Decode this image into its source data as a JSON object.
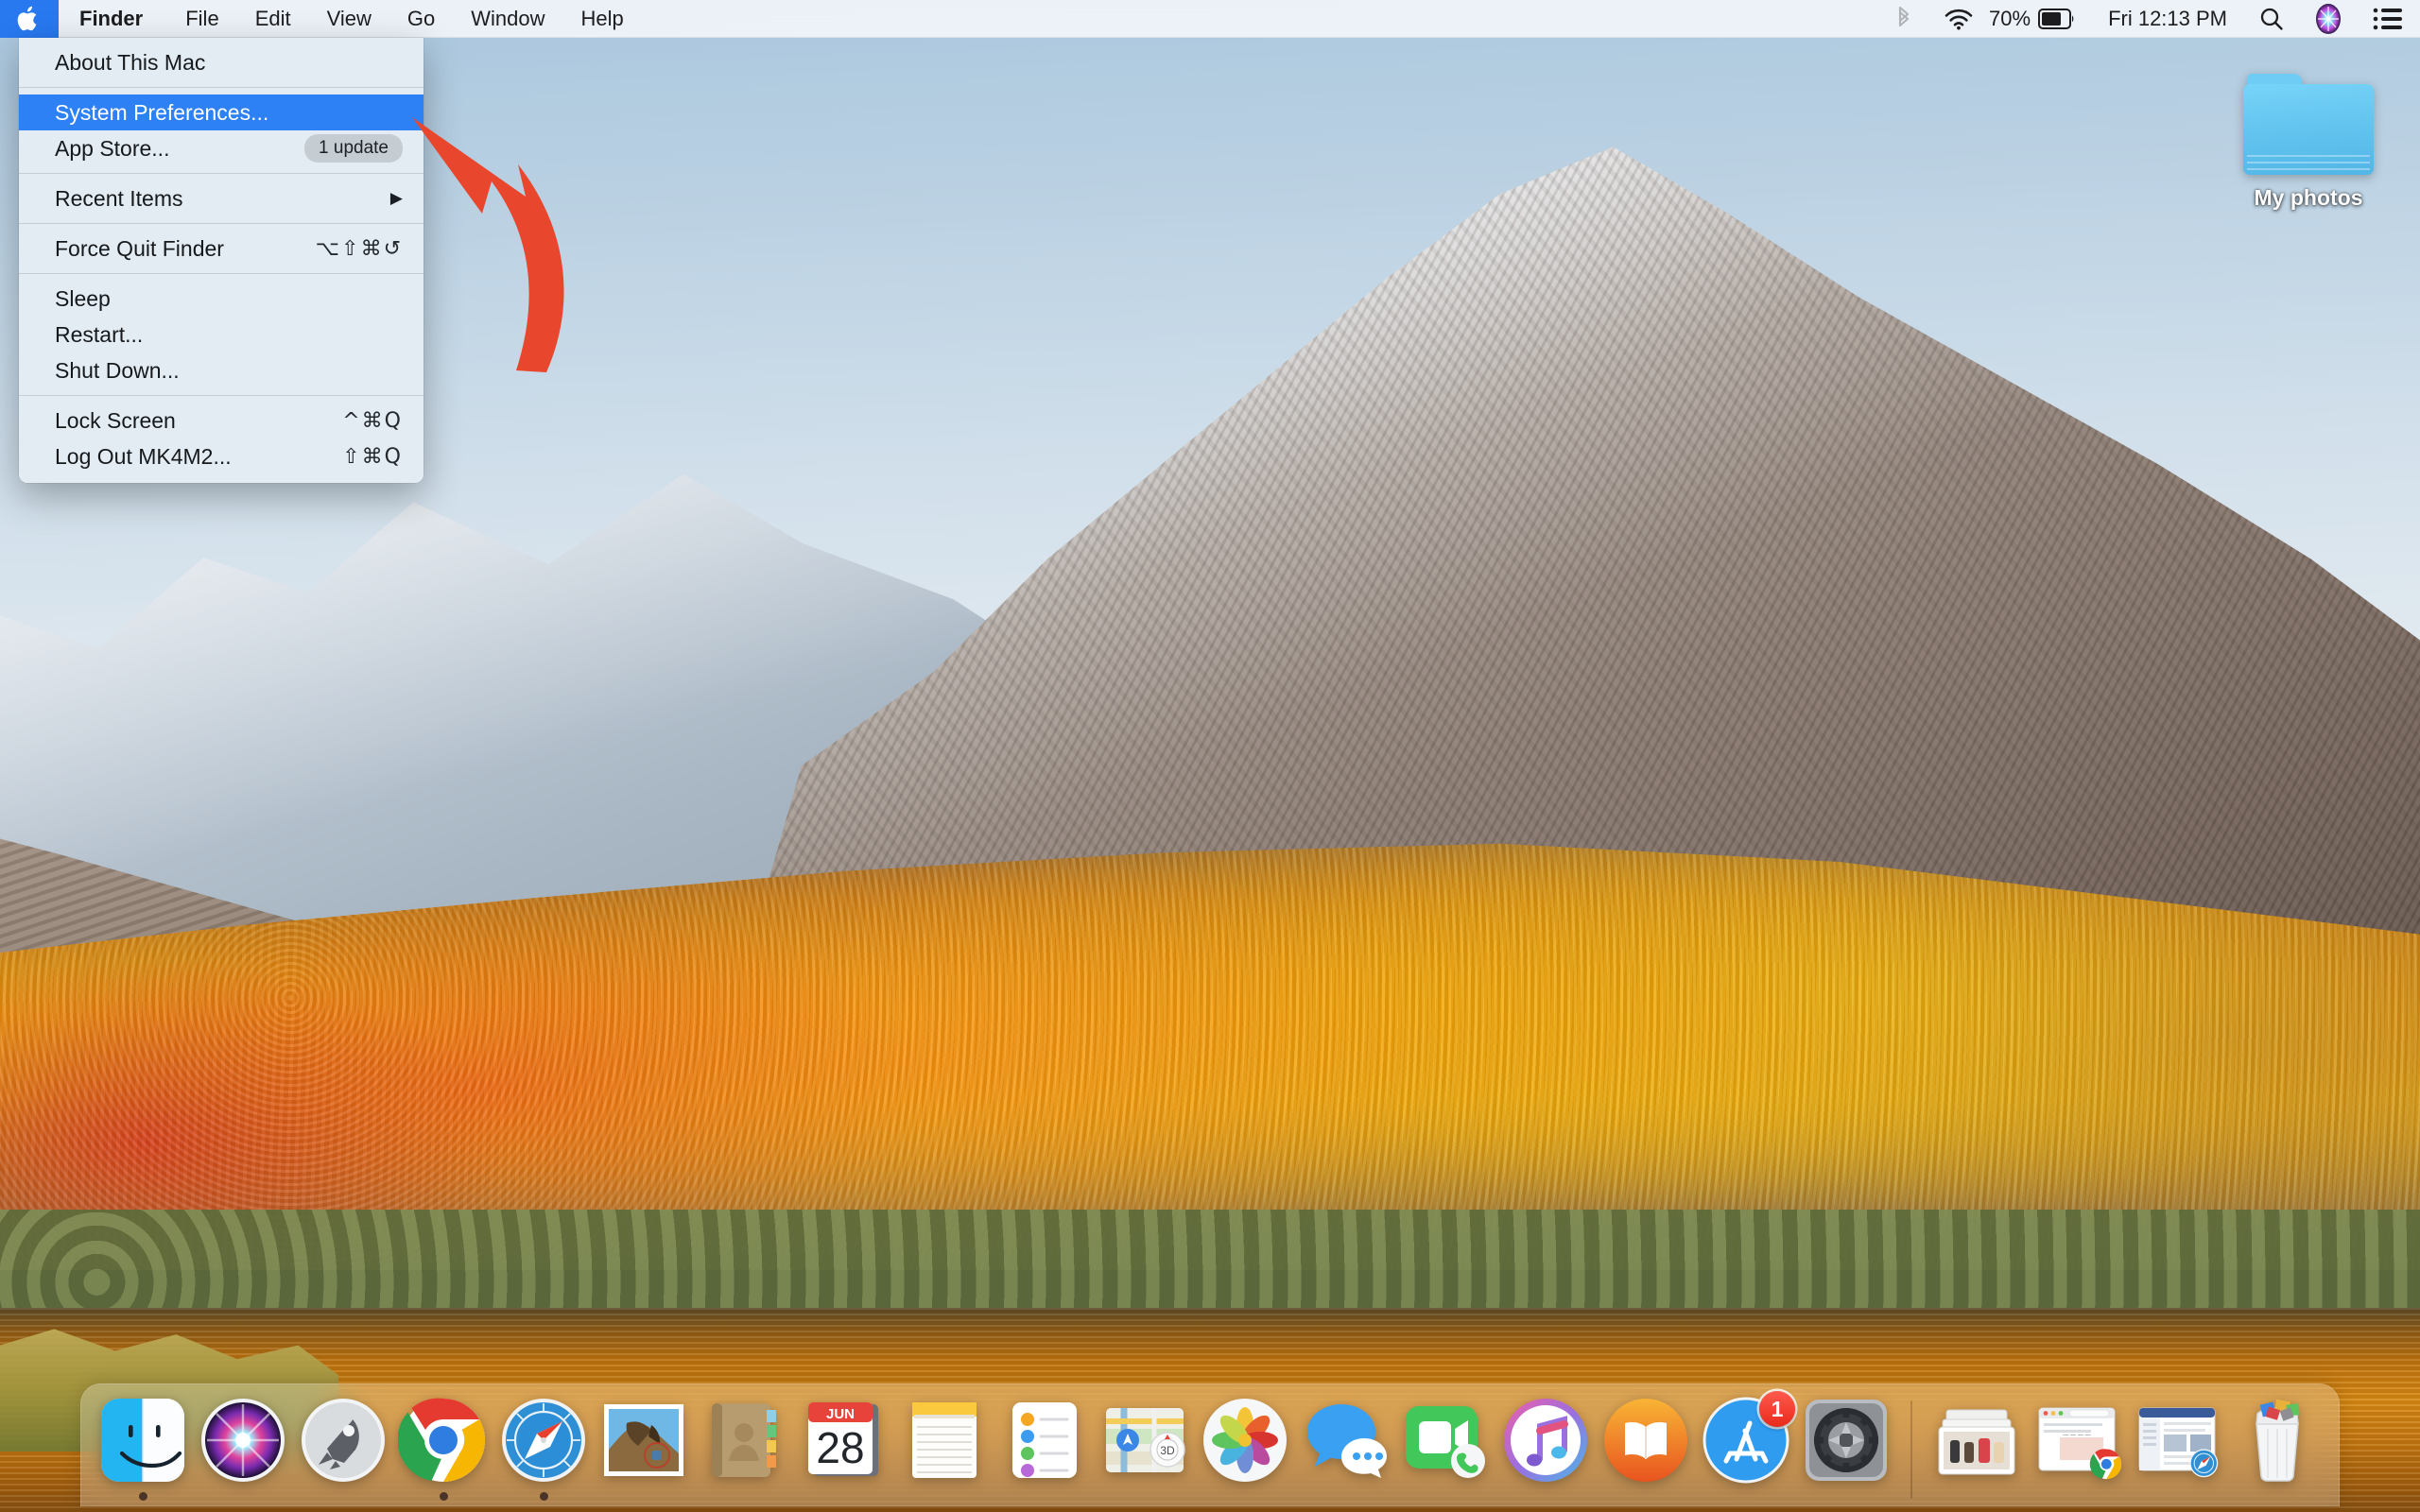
{
  "menubar": {
    "apple_icon": "apple-logo-icon",
    "items": [
      {
        "label": "Finder",
        "bold": true
      },
      {
        "label": "File",
        "bold": false
      },
      {
        "label": "Edit",
        "bold": false
      },
      {
        "label": "View",
        "bold": false
      },
      {
        "label": "Go",
        "bold": false
      },
      {
        "label": "Window",
        "bold": false
      },
      {
        "label": "Help",
        "bold": false
      }
    ],
    "status": {
      "bluetooth_icon": "bluetooth-icon",
      "wifi_icon": "wifi-icon",
      "battery_percent": "70%",
      "battery_icon": "battery-icon",
      "clock": "Fri 12:13 PM",
      "search_icon": "search-icon",
      "siri_icon": "siri-icon",
      "control_center_icon": "notification-center-icon"
    }
  },
  "apple_menu": {
    "selected_index": 1,
    "highlight_color": "#2d81f5",
    "rows": [
      {
        "label": "About This Mac",
        "key": "",
        "badge": "",
        "submenu": false,
        "sep_after": true
      },
      {
        "label": "System Preferences...",
        "key": "",
        "badge": "",
        "submenu": false,
        "sep_after": false
      },
      {
        "label": "App Store...",
        "key": "",
        "badge": "1 update",
        "submenu": false,
        "sep_after": true
      },
      {
        "label": "Recent Items",
        "key": "",
        "badge": "",
        "submenu": true,
        "sep_after": true
      },
      {
        "label": "Force Quit Finder",
        "key": "⌥⇧⌘↺",
        "badge": "",
        "submenu": false,
        "sep_after": true
      },
      {
        "label": "Sleep",
        "key": "",
        "badge": "",
        "submenu": false,
        "sep_after": false
      },
      {
        "label": "Restart...",
        "key": "",
        "badge": "",
        "submenu": false,
        "sep_after": false
      },
      {
        "label": "Shut Down...",
        "key": "",
        "badge": "",
        "submenu": false,
        "sep_after": true
      },
      {
        "label": "Lock Screen",
        "key": "^⌘Q",
        "badge": "",
        "submenu": false,
        "sep_after": false
      },
      {
        "label": "Log Out MK4M2...",
        "key": "⇧⌘Q",
        "badge": "",
        "submenu": false,
        "sep_after": false
      }
    ]
  },
  "annotation": {
    "arrow_name": "red-curved-arrow-pointing-to-system-preferences",
    "color": "#e8472e"
  },
  "desktop": {
    "folder": {
      "name": "My photos",
      "icon": "folder-icon",
      "color": "#63c4ef"
    }
  },
  "dock": {
    "apps": [
      {
        "name": "Finder",
        "icon": "finder-icon",
        "running": true,
        "badge": ""
      },
      {
        "name": "Siri",
        "icon": "siri-icon",
        "running": false,
        "badge": ""
      },
      {
        "name": "Launchpad",
        "icon": "launchpad-icon",
        "running": false,
        "badge": ""
      },
      {
        "name": "Google Chrome",
        "icon": "chrome-icon",
        "running": true,
        "badge": ""
      },
      {
        "name": "Safari",
        "icon": "safari-icon",
        "running": true,
        "badge": ""
      },
      {
        "name": "Mail",
        "icon": "mail-icon",
        "running": false,
        "badge": ""
      },
      {
        "name": "Contacts",
        "icon": "contacts-icon",
        "running": false,
        "badge": ""
      },
      {
        "name": "Calendar",
        "icon": "calendar-icon",
        "running": false,
        "badge": "",
        "month": "JUN",
        "day": "28"
      },
      {
        "name": "Notes",
        "icon": "notes-icon",
        "running": false,
        "badge": ""
      },
      {
        "name": "Reminders",
        "icon": "reminders-icon",
        "running": false,
        "badge": ""
      },
      {
        "name": "Maps",
        "icon": "maps-icon",
        "running": false,
        "badge": "",
        "label_3d": "3D"
      },
      {
        "name": "Photos",
        "icon": "photos-icon",
        "running": false,
        "badge": ""
      },
      {
        "name": "Messages",
        "icon": "messages-icon",
        "running": false,
        "badge": ""
      },
      {
        "name": "FaceTime",
        "icon": "facetime-icon",
        "running": false,
        "badge": ""
      },
      {
        "name": "iTunes",
        "icon": "itunes-icon",
        "running": false,
        "badge": ""
      },
      {
        "name": "Books",
        "icon": "books-icon",
        "running": false,
        "badge": ""
      },
      {
        "name": "App Store",
        "icon": "app-store-icon",
        "running": false,
        "badge": "1"
      },
      {
        "name": "System Preferences",
        "icon": "system-preferences-icon",
        "running": false,
        "badge": ""
      }
    ],
    "minimized": [
      {
        "name": "Stack / Downloads",
        "icon": "stack-icon"
      },
      {
        "name": "Minimized Chrome window",
        "icon": "minimized-window-chrome-icon"
      },
      {
        "name": "Minimized Safari window",
        "icon": "minimized-window-safari-icon"
      }
    ],
    "trash": {
      "name": "Trash",
      "icon": "trash-full-icon"
    }
  }
}
